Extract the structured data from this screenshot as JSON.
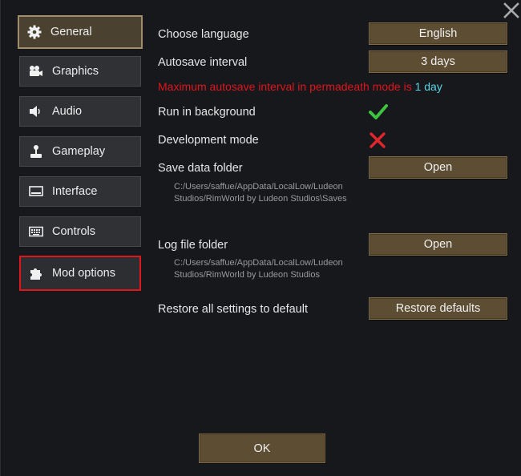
{
  "sidebar": {
    "items": [
      {
        "label": "General",
        "icon": "gear-icon"
      },
      {
        "label": "Graphics",
        "icon": "video-camera-icon"
      },
      {
        "label": "Audio",
        "icon": "speaker-icon"
      },
      {
        "label": "Gameplay",
        "icon": "joystick-icon"
      },
      {
        "label": "Interface",
        "icon": "monitor-icon"
      },
      {
        "label": "Controls",
        "icon": "keyboard-icon"
      },
      {
        "label": "Mod options",
        "icon": "puzzle-icon"
      }
    ],
    "active": "General",
    "highlighted": "Mod options",
    "highlight_color": "#e0161c"
  },
  "settings": {
    "language_label": "Choose language",
    "language_value": "English",
    "autosave_label": "Autosave interval",
    "autosave_value": "3 days",
    "warning_prefix": "Maximum autosave interval in permadeath mode is ",
    "warning_value": "1 day",
    "run_background_label": "Run in background",
    "run_background_value": "checked",
    "dev_mode_label": "Development mode",
    "dev_mode_value": "unchecked",
    "save_folder_label": "Save data folder",
    "save_folder_button": "Open",
    "save_folder_path": "C:/Users/saffue/AppData/LocalLow/Ludeon Studios/RimWorld by Ludeon Studios\\Saves",
    "log_folder_label": "Log file folder",
    "log_folder_button": "Open",
    "log_folder_path": "C:/Users/saffue/AppData/LocalLow/Ludeon Studios/RimWorld by Ludeon Studios",
    "restore_label": "Restore all settings to default",
    "restore_button": "Restore defaults"
  },
  "footer": {
    "ok_label": "OK"
  },
  "colors": {
    "button_fill": "#5d4d33",
    "warning": "#e0161c",
    "highlight_value": "#5cd6e6",
    "check": "#3ec43e",
    "cross": "#e0262a"
  }
}
